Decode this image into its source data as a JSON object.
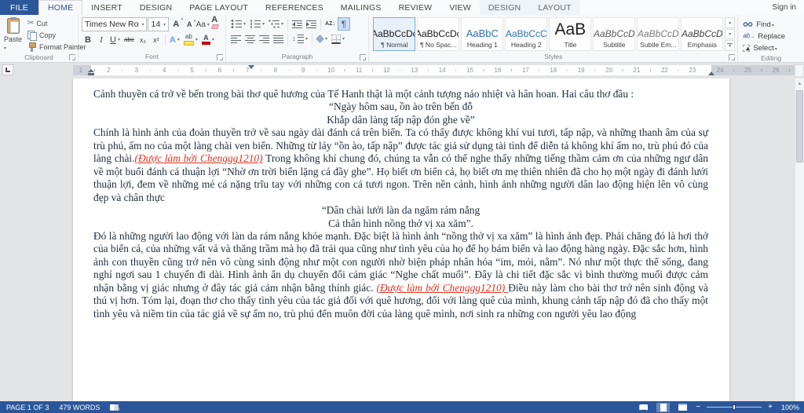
{
  "window": {
    "sign_in": "Sign in"
  },
  "ribbon": {
    "tabs": [
      {
        "label": "FILE",
        "type": "file"
      },
      {
        "label": "HOME",
        "active": true
      },
      {
        "label": "INSERT"
      },
      {
        "label": "DESIGN"
      },
      {
        "label": "PAGE LAYOUT"
      },
      {
        "label": "REFERENCES"
      },
      {
        "label": "MAILINGS"
      },
      {
        "label": "REVIEW"
      },
      {
        "label": "VIEW"
      },
      {
        "label": "DESIGN",
        "contextual": true
      },
      {
        "label": "LAYOUT",
        "contextual": true
      }
    ],
    "clipboard": {
      "label": "Clipboard",
      "paste": "Paste",
      "cut": "Cut",
      "copy": "Copy",
      "format_painter": "Format Painter"
    },
    "font": {
      "label": "Font",
      "family": "Times New Ro",
      "size": "14"
    },
    "paragraph": {
      "label": "Paragraph"
    },
    "styles": {
      "label": "Styles",
      "items": [
        {
          "preview": "AaBbCcDc",
          "name": "¶ Normal",
          "kind": "normal",
          "selected": true
        },
        {
          "preview": "AaBbCcDc",
          "name": "¶ No Spac...",
          "kind": "normal"
        },
        {
          "preview": "AaBbC",
          "name": "Heading 1",
          "kind": "h1"
        },
        {
          "preview": "AaBbCcC",
          "name": "Heading 2",
          "kind": "h2"
        },
        {
          "preview": "AaB",
          "name": "Title",
          "kind": "title"
        },
        {
          "preview": "AaBbCcD",
          "name": "Subtitle",
          "kind": "subtitle"
        },
        {
          "preview": "AaBbCcD",
          "name": "Subtle Em...",
          "kind": "subtle"
        },
        {
          "preview": "AaBbCcD",
          "name": "Emphasis",
          "kind": "emphasis"
        }
      ]
    },
    "editing": {
      "label": "Editing",
      "find": "Find",
      "replace": "Replace",
      "select": "Select"
    }
  },
  "glyphs": {
    "cut": "✂",
    "bold": "B",
    "italic": "I",
    "underline": "U",
    "strike": "abc",
    "subscript": "x₂",
    "superscript": "x²",
    "grow_font": "A",
    "shrink_font": "A",
    "change_case": "Aa",
    "clear_format": "A",
    "text_effects": "A",
    "highlight": "ab",
    "font_color": "A",
    "sort": "AZ",
    "pilcrow": "¶",
    "scroll_up": "▲"
  },
  "ruler": {
    "numbers": [
      "1",
      "2",
      "3",
      "4",
      "5",
      "6",
      "7",
      "8",
      "9",
      "10",
      "11",
      "12",
      "13",
      "14",
      "15",
      "16",
      "17",
      "18",
      "19",
      "20",
      "21",
      "22",
      "23",
      "24",
      "25",
      "26"
    ]
  },
  "document": {
    "paragraphs": [
      {
        "align": "justify",
        "runs": [
          {
            "text": "Cảnh thuyền cá trở về bến trong bài thơ quê hương của Tế Hanh thật là một cảnh tượng náo nhiệt và hân hoan. Hai câu thơ đầu :"
          }
        ]
      },
      {
        "align": "center",
        "runs": [
          {
            "text": "“Ngày hôm sau, ồn ào trên bến đỗ"
          }
        ]
      },
      {
        "align": "center",
        "runs": [
          {
            "text": "Khắp dân làng tấp nập đón ghe về”"
          }
        ]
      },
      {
        "align": "justify",
        "runs": [
          {
            "text": "Chính là hình ảnh của đoàn thuyền trở về sau ngày dài đánh cá trên biển. Ta có thấy được không khí vui tươi, tấp nập, và những thanh âm của sự trù phú, ấm no của một làng chài ven biển. Những từ láy “ồn ào, tấp nập” được tác giả sử dụng tài tình để diễn tả không khí ấm no, trù phú đó của làng chài."
          },
          {
            "text": "(Được làm bởi Chenggg1210)",
            "style": "credit"
          },
          {
            "text": " Trong không khí chung đó, chúng ta vẫn có thể nghe thấy những tiếng thầm cảm ơn của những ngư dân về một buổi đánh cá thuận lợi “Nhờ ơn trời biển lặng cá đầy ghe”. Họ biết ơn biển cả, họ biết ơn mẹ thiên nhiên đã cho họ một ngày đi đánh lưới thuận lợi, đem về những mẻ cá nặng trĩu tay với những con cá tươi ngon. Trên nền cảnh, hình ảnh những người dân lao động hiện lên vô cùng đẹp và chân thực"
          }
        ]
      },
      {
        "align": "center",
        "runs": [
          {
            "text": "“Dân chài lưới làn da ngăm rám nắng"
          }
        ]
      },
      {
        "align": "center",
        "runs": [
          {
            "text": "Cả thân hình nồng thở vị xa xăm”."
          }
        ]
      },
      {
        "align": "justify",
        "runs": [
          {
            "text": "Đó là những người lao động với làn da rám nắng khỏe mạnh. Đặc biệt là hình ảnh “nồng thở vị xa xăm” là hình ảnh đẹp. Phải chăng đó là hơi thở của biển cả, của những vất vả và thăng trầm mà họ đã trải qua cũng như tình yêu của họ để họ bám biển và lao động hàng ngày. Đặc sắc hơn, hình ảnh con thuyền cũng trở nên vô cùng sinh động như một con người nhờ biện pháp nhân hóa “im, mỏi, nằm”. Nó như một thực thể sống, đang nghỉ ngơi sau 1 chuyến đi dài. Hình ảnh ẩn dụ chuyển đổi cảm giác “Nghe chất muối”. Đây là chi tiết đặc sắc vì bình thường muối được cảm nhận bằng vị giác nhưng ở đây tác giả cảm nhận bằng thính giác. "
          },
          {
            "text": "(Được làm bởi Chenggg1210) ",
            "style": "credit"
          },
          {
            "text": "Điều này làm cho bài thơ trở nên sinh động và thú vị hơn. Tóm lại, đoạn thơ cho thấy tình yêu của tác giả đối với quê hương, đối với làng quê của mình, khung cảnh tấp nập đó đã cho thấy một tình yêu và niềm tin của tác giả về sự ấm no, trù phú đến muôn đời của làng quê mình, nơi sinh ra những con người yêu lao động"
          }
        ]
      }
    ]
  },
  "status": {
    "page": "PAGE 1 OF 3",
    "words": "479 WORDS",
    "zoom_level": "100%"
  },
  "colors": {
    "accent": "#2b579a",
    "annotation_red": "#e0301e",
    "heading_blue": "#2e74b5"
  }
}
